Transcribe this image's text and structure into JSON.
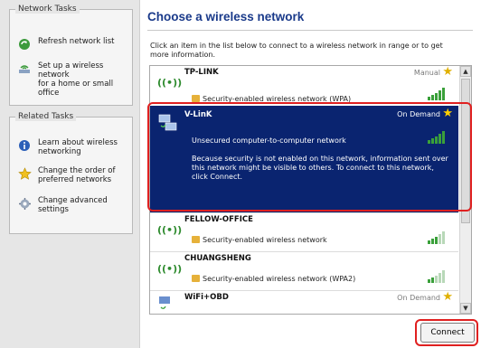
{
  "task_pane": {
    "network_tasks": {
      "title": "Network Tasks",
      "items": [
        {
          "label": "Refresh network list",
          "icon": "refresh-icon"
        },
        {
          "label": "Set up a wireless network\nfor a home or small office",
          "icon": "setup-wireless-icon"
        }
      ]
    },
    "related_tasks": {
      "title": "Related Tasks",
      "items": [
        {
          "label": "Learn about wireless\nnetworking",
          "icon": "info-icon"
        },
        {
          "label": "Change the order of\npreferred networks",
          "icon": "star-icon"
        },
        {
          "label": "Change advanced\nsettings",
          "icon": "settings-icon"
        }
      ]
    }
  },
  "main": {
    "title": "Choose a wireless network",
    "instructions": "Click an item in the list below to connect to a wireless network in range or to get more information.",
    "networks": [
      {
        "ssid": "TP-LINK",
        "mode": "Manual",
        "security": "Security-enabled wireless network (WPA)",
        "signal_bars": 5
      },
      {
        "ssid": "V-LinK",
        "mode": "On Demand",
        "security": "Unsecured computer-to-computer network",
        "description": "Because security is not enabled on this network, information sent over this network might be visible to others. To connect to this network, click Connect.",
        "signal_bars": 5
      },
      {
        "ssid": "FELLOW-OFFICE",
        "mode": "",
        "security": "Security-enabled wireless network",
        "signal_bars": 3
      },
      {
        "ssid": "CHUANGSHENG",
        "mode": "",
        "security": "Security-enabled wireless network (WPA2)",
        "signal_bars": 2
      },
      {
        "ssid": "WiFi+OBD",
        "mode": "On Demand",
        "security": "",
        "signal_bars": 0
      }
    ],
    "connect_label": "Connect"
  },
  "colors": {
    "selected_bg": "#0a2470",
    "title": "#1a3a8a",
    "highlight": "#e02020",
    "signal": "#3aa03a"
  }
}
